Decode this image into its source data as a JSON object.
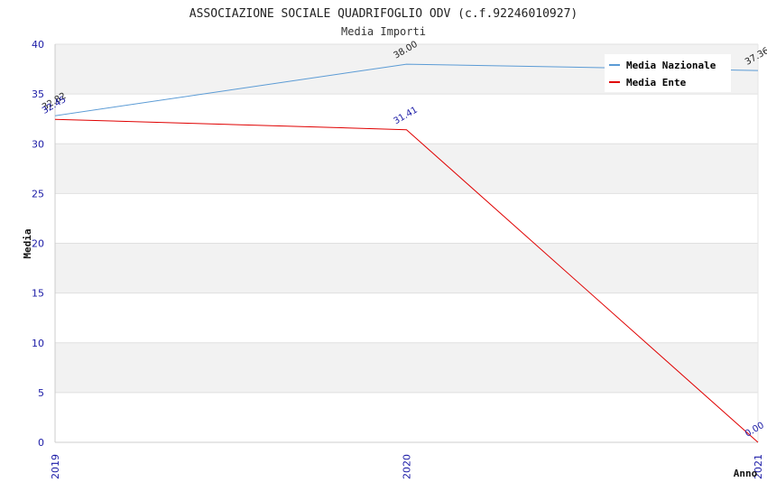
{
  "chart_data": {
    "type": "line",
    "title": "ASSOCIAZIONE SOCIALE QUADRIFOGLIO ODV (c.f.92246010927)",
    "subtitle": "Media Importi",
    "xlabel": "Anno",
    "ylabel": "Media",
    "categories": [
      "2019",
      "2020",
      "2021"
    ],
    "ylim": [
      0,
      40
    ],
    "yticks": [
      0,
      5,
      10,
      15,
      20,
      25,
      30,
      35,
      40
    ],
    "grid": true,
    "legend_position": "top-right",
    "series": [
      {
        "name": "Media Nazionale",
        "color": "#5b9bd5",
        "label_color": "#222222",
        "values": [
          32.82,
          38.0,
          37.36
        ],
        "labels": [
          "32.82",
          "38.00",
          "37.36"
        ]
      },
      {
        "name": "Media Ente",
        "color": "#e00000",
        "label_color": "#1a1aa6",
        "values": [
          32.45,
          31.41,
          0.0
        ],
        "labels": [
          "32.45",
          "31.41",
          "0.00"
        ]
      }
    ]
  }
}
